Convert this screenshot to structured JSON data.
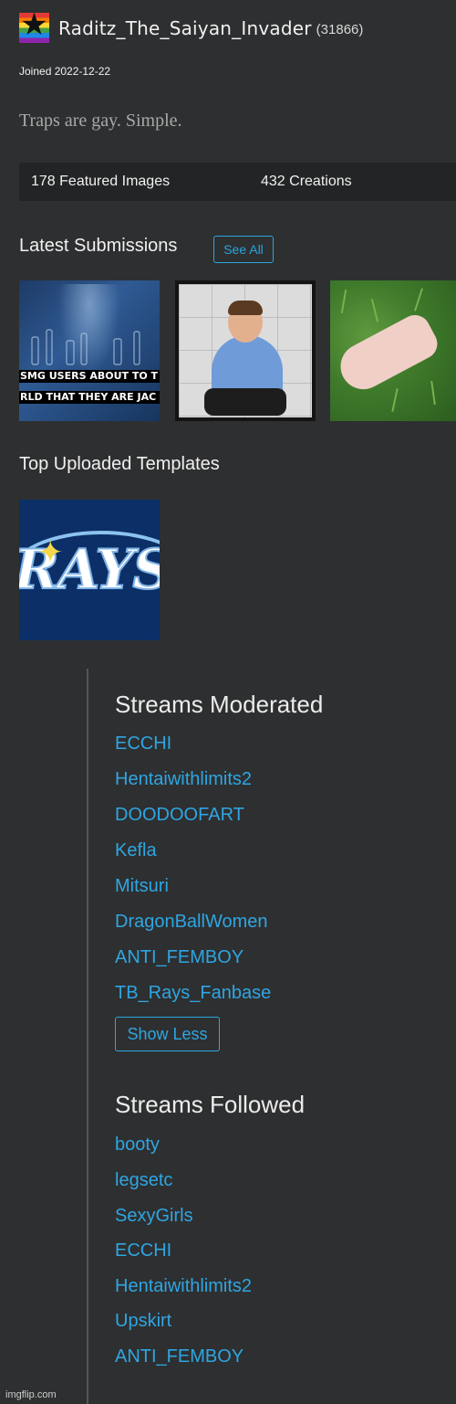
{
  "profile": {
    "username": "Raditz_The_Saiyan_Invader",
    "points": "(31866)",
    "joined": "Joined 2022-12-22",
    "bio": "Traps are gay. Simple.",
    "icon": "rainbow-flag-star-icon"
  },
  "stats": {
    "featured": "178 Featured Images",
    "creations": "432 Creations"
  },
  "latest": {
    "title": "Latest Submissions",
    "see_all": "See All",
    "thumb1_caption_line1": "SMG USERS ABOUT TO T",
    "thumb1_caption_line2": "RLD THAT THEY ARE JAC"
  },
  "top_templates": {
    "title": "Top Uploaded Templates",
    "logo_text": "RAYS"
  },
  "streams_moderated": {
    "title": "Streams Moderated",
    "items": [
      "ECCHI",
      "Hentaiwithlimits2",
      "DOODOOFART",
      "Kefla",
      "Mitsuri",
      "DragonBallWomen",
      "ANTI_FEMBOY",
      "TB_Rays_Fanbase"
    ],
    "show_less": "Show Less"
  },
  "streams_followed": {
    "title": "Streams Followed",
    "items": [
      "booty",
      "legsetc",
      "SexyGirls",
      "ECCHI",
      "Hentaiwithlimits2",
      "Upskirt",
      "ANTI_FEMBOY"
    ]
  },
  "watermark": "imgflip.com",
  "colors": {
    "background": "#2e2f30",
    "link": "#2ea6e3",
    "stats_bar": "#232425"
  }
}
